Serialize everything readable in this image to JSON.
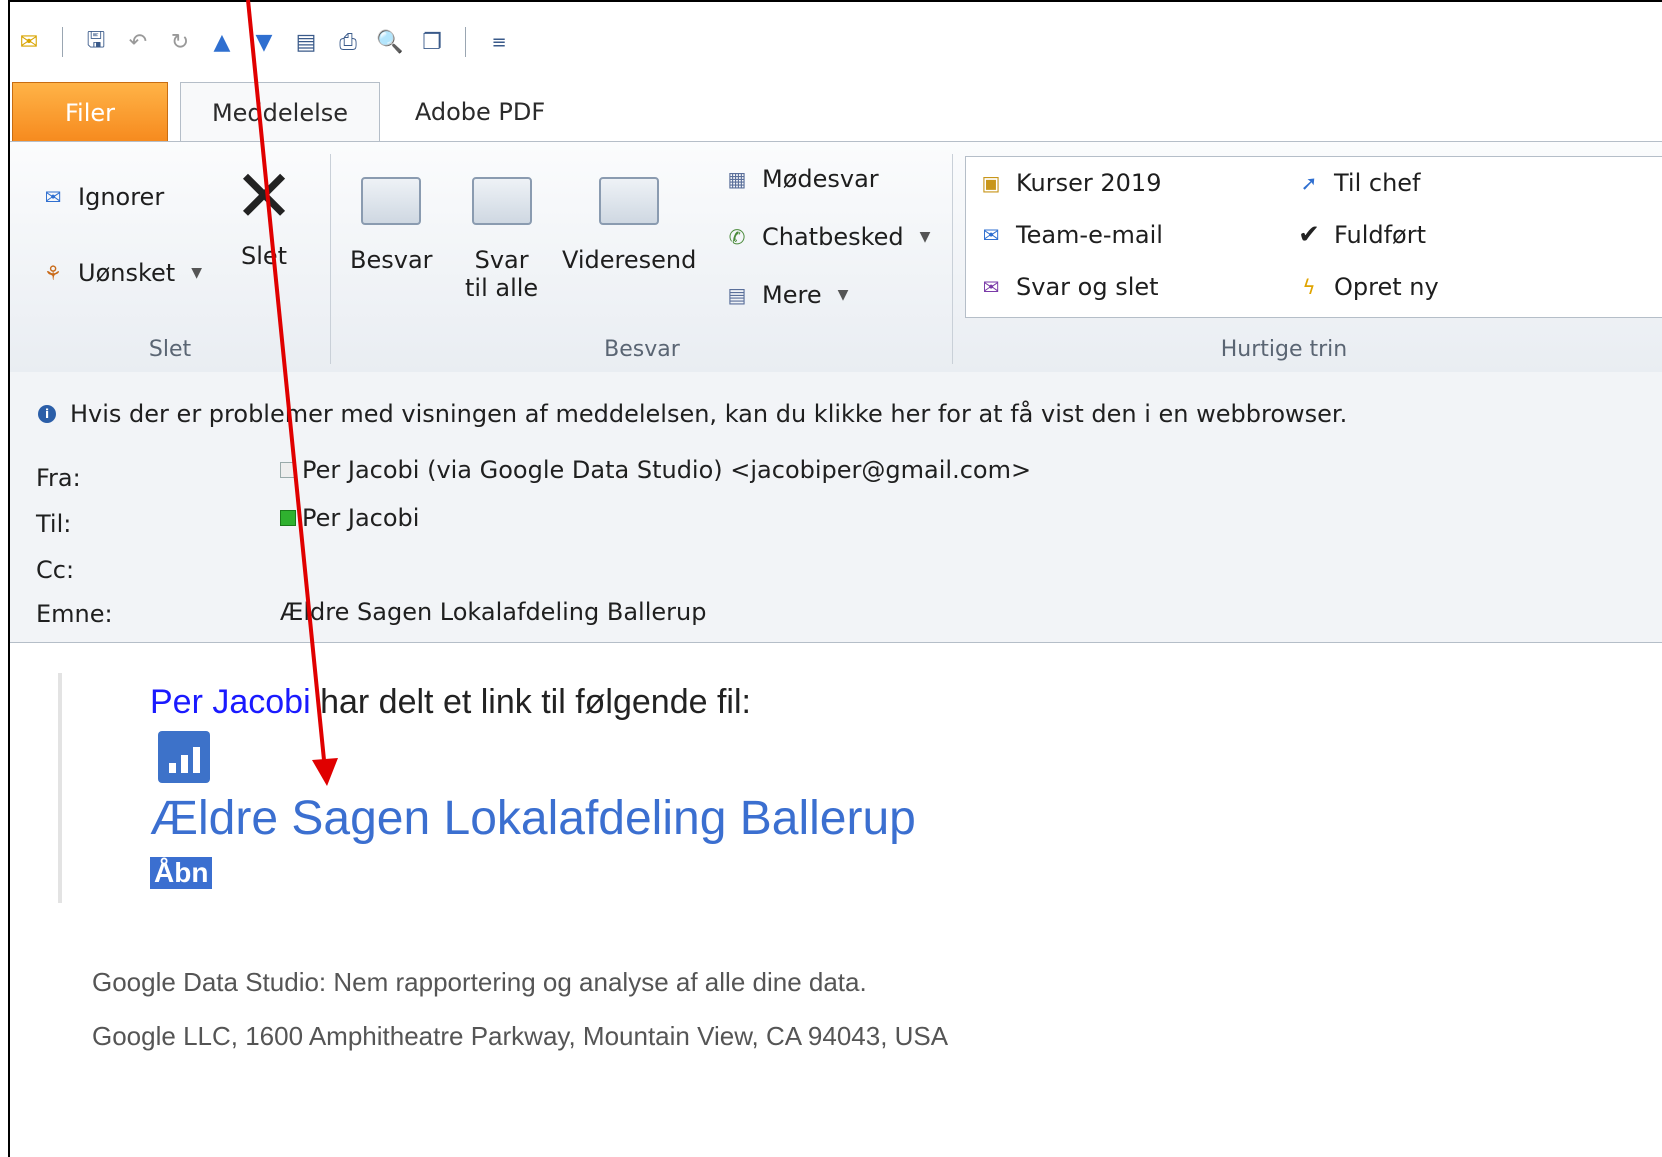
{
  "tabs": {
    "file": "Filer",
    "message": "Meddelelse",
    "adobe": "Adobe PDF"
  },
  "ribbon": {
    "delete_group": {
      "label": "Slet",
      "ignore": "Ignorer",
      "junk": "Uønsket",
      "delete": "Slet"
    },
    "respond_group": {
      "label": "Besvar",
      "reply": "Besvar",
      "reply_all_line1": "Svar",
      "reply_all_line2": "til alle",
      "forward": "Videresend",
      "meeting": "Mødesvar",
      "chat": "Chatbesked",
      "more": "Mere"
    },
    "quick_steps": {
      "label": "Hurtige trin",
      "items": [
        "Kurser 2019",
        "Team-e-mail",
        "Svar og slet",
        "Til chef",
        "Fuldført",
        "Opret ny"
      ]
    }
  },
  "header": {
    "info": "Hvis der er problemer med visningen af meddelelsen, kan du klikke her for at få vist den i en webbrowser.",
    "from_label": "Fra:",
    "from_value": "Per Jacobi (via Google Data Studio) <jacobiper@gmail.com>",
    "to_label": "Til:",
    "to_value": "Per Jacobi",
    "cc_label": "Cc:",
    "subject_label": "Emne:",
    "subject_value": "Ældre Sagen Lokalafdeling Ballerup"
  },
  "body": {
    "sharer": "Per Jacobi",
    "shared_text": "har delt et link til følgende fil:",
    "file_name": "Ældre Sagen Lokalafdeling Ballerup",
    "open_label": "Åbn",
    "footer_line1": "Google Data Studio: Nem rapportering og analyse af alle dine data.",
    "footer_line2": "Google LLC, 1600 Amphitheatre Parkway, Mountain View, CA 94043, USA"
  },
  "colors": {
    "file_tab": "#f68a1e",
    "link": "#3b6fd0",
    "annotation": "#e00000"
  }
}
